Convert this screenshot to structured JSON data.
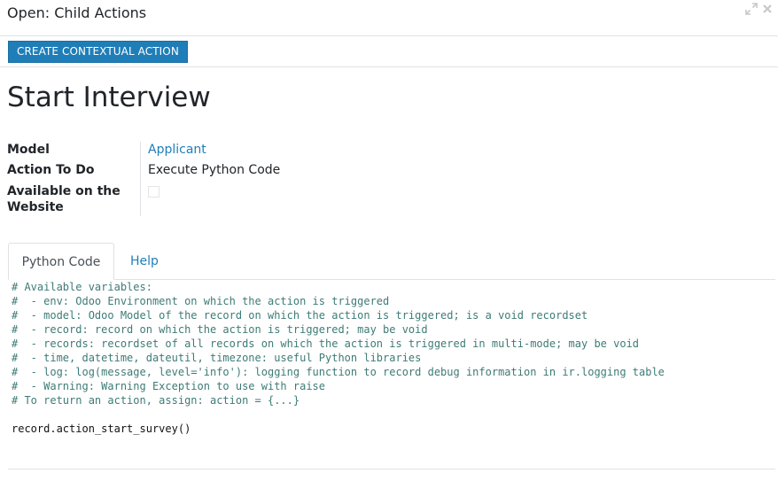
{
  "dialog": {
    "title": "Open: Child Actions",
    "expand_icon": "expand-arrows-icon",
    "close_icon": "close-icon"
  },
  "toolbar": {
    "create_contextual_action_label": "CREATE CONTEXTUAL ACTION"
  },
  "record": {
    "title": "Start Interview"
  },
  "fields": {
    "model_label": "Model",
    "model_value": "Applicant",
    "action_label": "Action To Do",
    "action_value": "Execute Python Code",
    "website_label": "Available on the Website",
    "website_checked": false
  },
  "tabs": [
    {
      "label": "Python Code",
      "active": true
    },
    {
      "label": "Help",
      "active": false
    }
  ],
  "code": {
    "lines": [
      {
        "text": "# Available variables:",
        "kind": "comment"
      },
      {
        "text": "#  - env: Odoo Environment on which the action is triggered",
        "kind": "comment"
      },
      {
        "text": "#  - model: Odoo Model of the record on which the action is triggered; is a void recordset",
        "kind": "comment"
      },
      {
        "text": "#  - record: record on which the action is triggered; may be void",
        "kind": "comment"
      },
      {
        "text": "#  - records: recordset of all records on which the action is triggered in multi-mode; may be void",
        "kind": "comment"
      },
      {
        "text": "#  - time, datetime, dateutil, timezone: useful Python libraries",
        "kind": "comment"
      },
      {
        "text": "#  - log: log(message, level='info'): logging function to record debug information in ir.logging table",
        "kind": "comment"
      },
      {
        "text": "#  - Warning: Warning Exception to use with raise",
        "kind": "comment"
      },
      {
        "text": "# To return an action, assign: action = {...}",
        "kind": "comment"
      },
      {
        "text": "",
        "kind": "blank"
      },
      {
        "text": "record.action_start_survey()",
        "kind": "code"
      }
    ]
  },
  "colors": {
    "primary": "#1f7eb8",
    "comment": "#3d7b76",
    "border": "#dee2e6"
  }
}
